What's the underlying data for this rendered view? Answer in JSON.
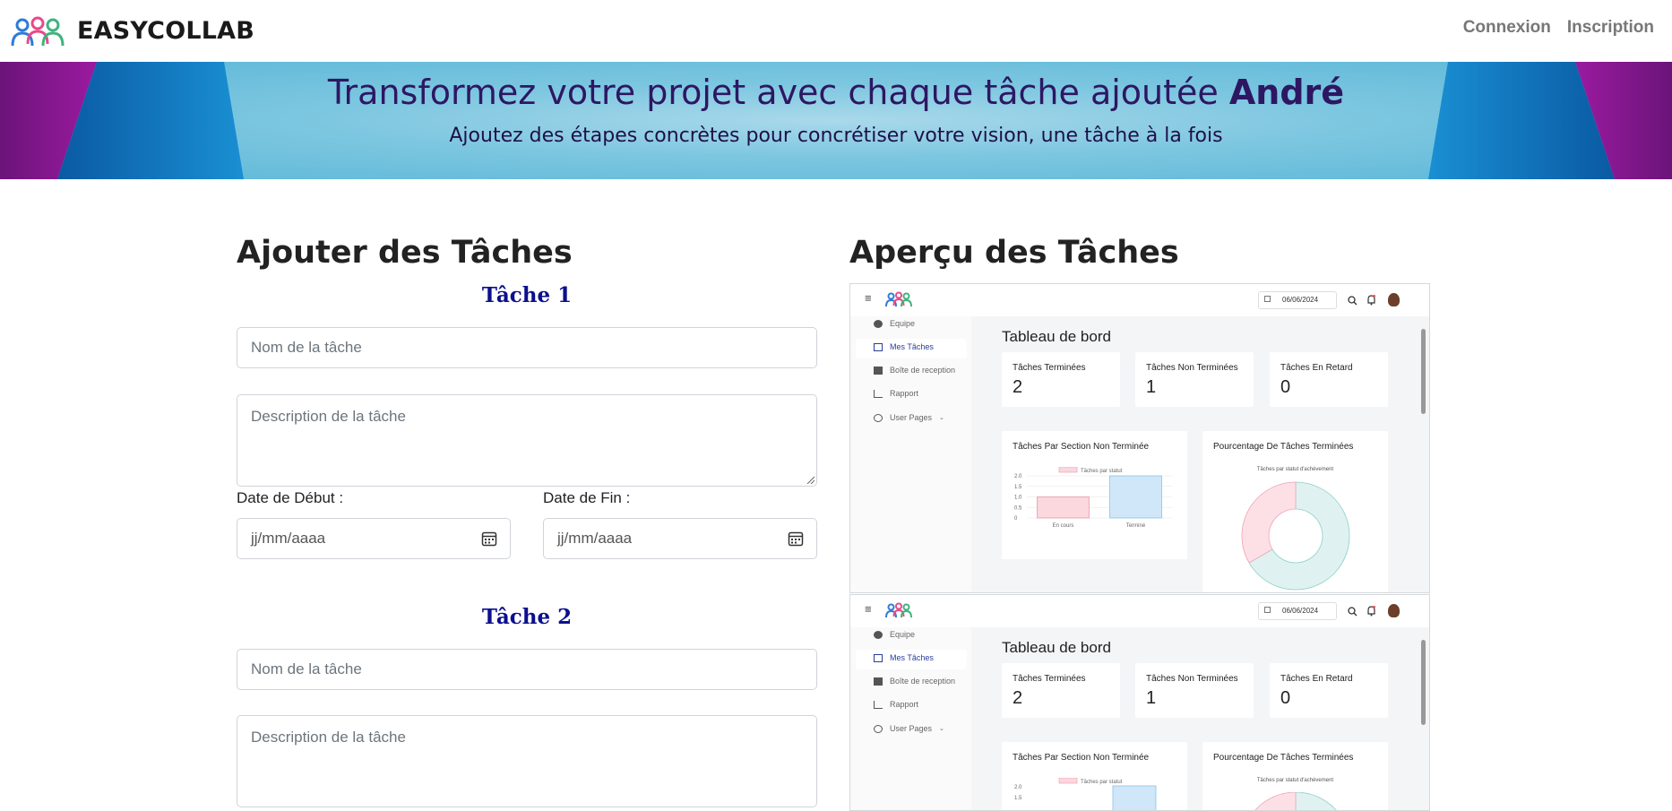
{
  "navbar": {
    "brand": "EASYCOLLAB",
    "links": [
      "Connexion",
      "Inscription"
    ]
  },
  "banner": {
    "title_prefix": "Transformez votre projet avec chaque tâche ajoutée",
    "title_name": "André",
    "subtitle": "Ajoutez des étapes concrètes pour concrétiser votre vision, une tâche à la fois"
  },
  "form": {
    "heading": "Ajouter des Tâches",
    "tasks": [
      {
        "title": "Tâche 1",
        "name_placeholder": "Nom de la tâche",
        "desc_placeholder": "Description de la tâche",
        "start_label": "Date de Début :",
        "end_label": "Date de Fin :",
        "start_value": "jj/mm/aaaa",
        "end_value": "jj/mm/aaaa"
      },
      {
        "title": "Tâche 2",
        "name_placeholder": "Nom de la tâche",
        "desc_placeholder": "Description de la tâche"
      }
    ]
  },
  "preview": {
    "heading": "Aperçu des Tâches",
    "screenshots": [
      {
        "date": "06/06/2024",
        "sidebar": [
          "Equipe",
          "Mes Tâches",
          "Boîte de reception",
          "Rapport",
          "User Pages"
        ],
        "dashboard_title": "Tableau de bord",
        "stats": [
          {
            "label": "Tâches Terminées",
            "value": "2"
          },
          {
            "label": "Tâches Non Terminées",
            "value": "1"
          },
          {
            "label": "Tâches En Retard",
            "value": "0"
          }
        ],
        "bar_card_title": "Tâches Par Section Non Terminée",
        "pie_card_title": "Pourcentage De Tâches Terminées",
        "bar_legend": "Tâches par statut",
        "bar_categories": [
          "En cours",
          "Terminé"
        ],
        "bar_values": [
          1,
          2
        ],
        "y_ticks": [
          "2.0",
          "1.5",
          "1.0",
          "0.5",
          "0"
        ],
        "pie_title": "Tâches par statut d'achèvement",
        "pie_values": [
          1,
          2
        ]
      },
      {
        "date": "06/06/2024",
        "sidebar": [
          "Equipe",
          "Mes Tâches",
          "Boîte de reception",
          "Rapport",
          "User Pages"
        ],
        "dashboard_title": "Tableau de bord",
        "stats": [
          {
            "label": "Tâches Terminées",
            "value": "2"
          },
          {
            "label": "Tâches Non Terminées",
            "value": "1"
          },
          {
            "label": "Tâches En Retard",
            "value": "0"
          }
        ],
        "bar_card_title": "Tâches Par Section Non Terminée",
        "pie_card_title": "Pourcentage De Tâches Terminées",
        "bar_legend": "Tâches par statut",
        "y_ticks": [
          "2.0",
          "1.5"
        ],
        "pie_title": "Tâches par statut d'achèvement"
      }
    ]
  },
  "colors": {
    "task_title": "#0b108f",
    "banner_title": "#2d1763",
    "bar_pink": "#fbd7de",
    "bar_blue": "#cfe7f8"
  }
}
